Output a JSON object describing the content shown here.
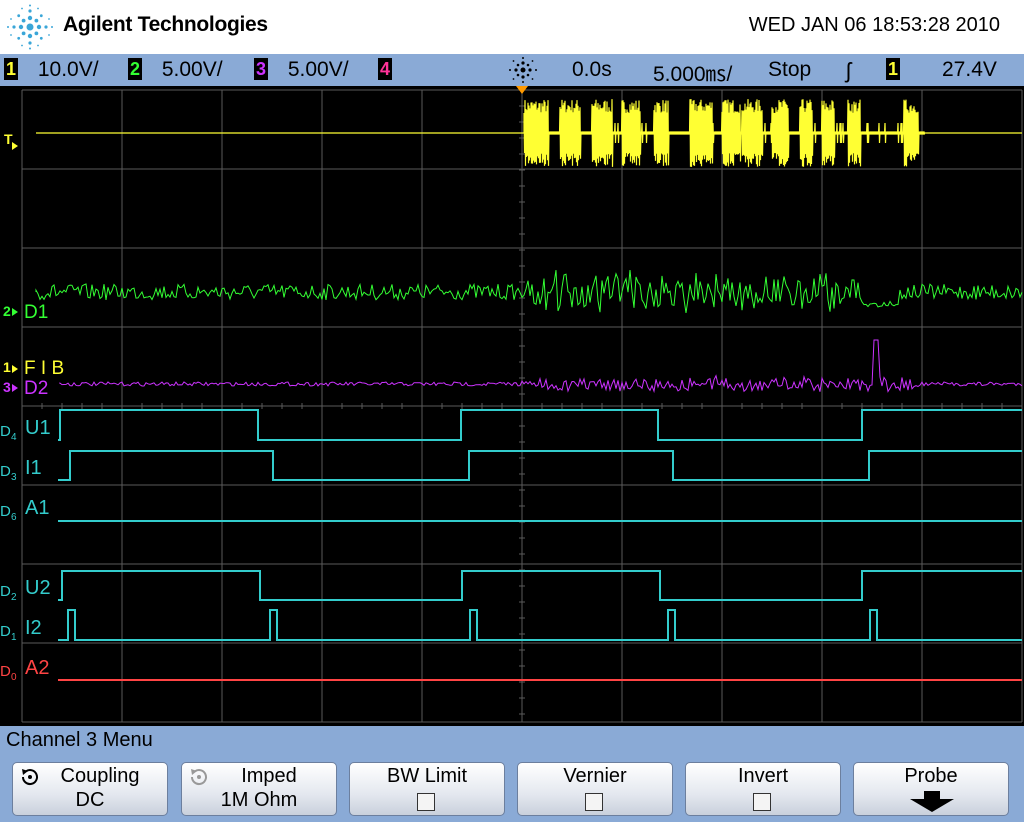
{
  "header": {
    "brand": "Agilent Technologies",
    "datetime": "WED JAN 06 18:53:28 2010",
    "logo_icon": "agilent-spark-icon"
  },
  "status": {
    "ch1_num": "1",
    "ch1_scale": "10.0V/",
    "ch2_num": "2",
    "ch2_scale": "5.00V/",
    "ch3_num": "3",
    "ch3_scale": "5.00V/",
    "ch4_num": "4",
    "trigger_icon": "trigger-spark-icon",
    "delay": "0.0s",
    "timebase": "5.000㎳/",
    "run_state": "Stop",
    "edge_icon": "rising-edge-icon",
    "edge_symbol": "ʃ",
    "trig_source": "1",
    "trig_level": "27.4V",
    "colors": {
      "ch1": "#ffff33",
      "ch2": "#33ff33",
      "ch3": "#cc33ff",
      "ch4": "#ff3399",
      "digital": "#33cccc",
      "digital_off": "#ff4444"
    }
  },
  "screen": {
    "trigger_marker": "T",
    "labels": {
      "ch2_marker": "2",
      "d1": "D1",
      "ch1_marker": "1",
      "fib": "F I B",
      "ch3_marker": "3",
      "d2": "D2",
      "u1_id": "4",
      "u1": "U1",
      "i1_id": "3",
      "i1": "I1",
      "a1_id": "6",
      "a1": "A1",
      "u2_id": "2",
      "u2": "U2",
      "i2_id": "1",
      "i2": "I2",
      "a2_id": "0",
      "a2": "A2",
      "digital_prefix": "D"
    }
  },
  "menu": {
    "title": "Channel 3  Menu",
    "softkeys": [
      {
        "line1": "Coupling",
        "line2": "DC",
        "icon": "rotate-select-icon"
      },
      {
        "line1": "Imped",
        "line2": "1M Ohm",
        "icon": "rotate-select-icon"
      },
      {
        "line1": "BW Limit",
        "checked": false
      },
      {
        "line1": "Vernier",
        "checked": false
      },
      {
        "line1": "Invert",
        "checked": false
      },
      {
        "line1": "Probe",
        "icon": "down-arrow-icon"
      }
    ]
  }
}
